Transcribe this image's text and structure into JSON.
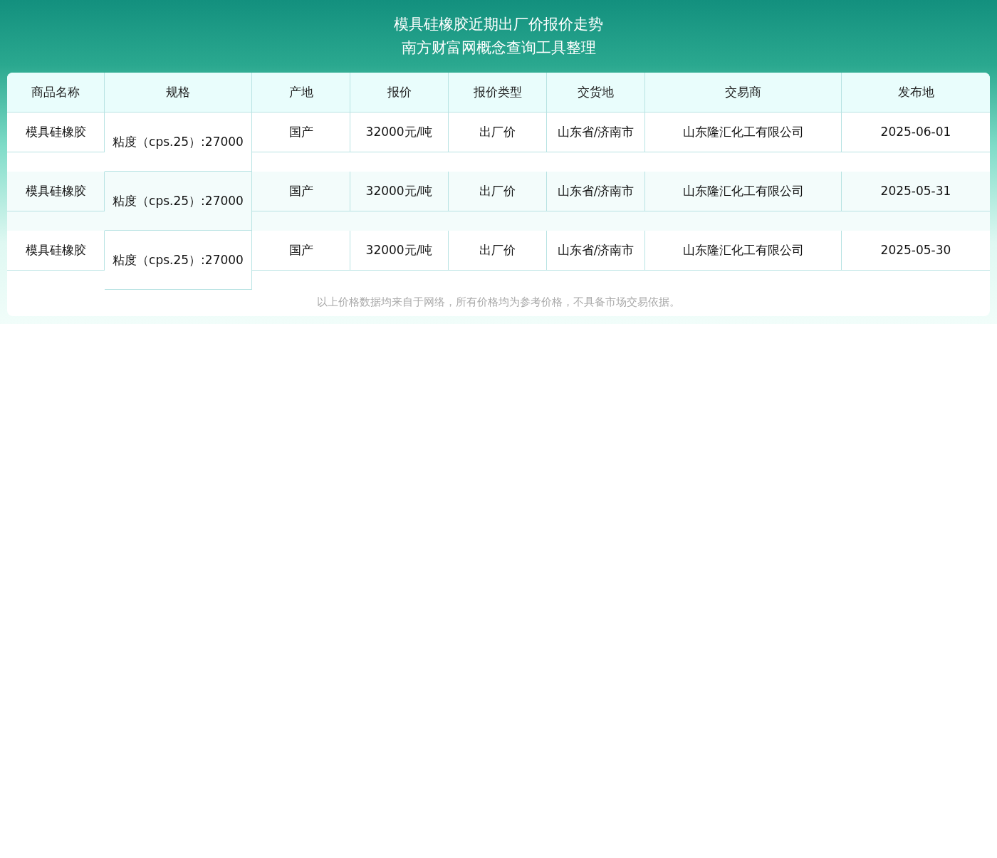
{
  "header": {
    "title": "模具硅橡胶近期出厂价报价走势",
    "subtitle": "南方财富网概念查询工具整理"
  },
  "table": {
    "columns": [
      "商品名称",
      "规格",
      "产地",
      "报价",
      "报价类型",
      "交货地",
      "交易商",
      "发布地"
    ],
    "rows": [
      {
        "cells": [
          "模具硅橡胶",
          "粘度（cps.25）:27000",
          "国产",
          "32000元/吨",
          "出厂价",
          "山东省/济南市",
          "山东隆汇化工有限公司",
          "2025-06-01"
        ]
      },
      {
        "cells": [
          "模具硅橡胶",
          "粘度（cps.25）:27000",
          "国产",
          "32000元/吨",
          "出厂价",
          "山东省/济南市",
          "山东隆汇化工有限公司",
          "2025-05-31"
        ]
      },
      {
        "cells": [
          "模具硅橡胶",
          "粘度（cps.25）:27000",
          "国产",
          "32000元/吨",
          "出厂价",
          "山东省/济南市",
          "山东隆汇化工有限公司",
          "2025-05-30"
        ]
      }
    ]
  },
  "footnote": "以上价格数据均来自于网络，所有价格均为参考价格，不具备市场交易依据。"
}
